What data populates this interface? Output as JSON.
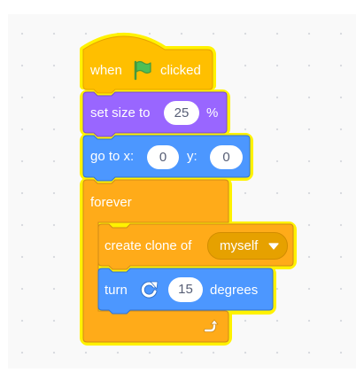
{
  "colors": {
    "events": "#ffbf00",
    "control": "#ffab19",
    "looks": "#9966ff",
    "motion": "#4c97ff",
    "glow": "#fff200"
  },
  "blocks": {
    "when_flag": {
      "label_when": "when",
      "icon": "green-flag-icon",
      "label_clicked": "clicked"
    },
    "set_size": {
      "label": "set size to",
      "value": "25",
      "unit": "%"
    },
    "go_to": {
      "label_x": "go to x:",
      "x_value": "0",
      "label_y": "y:",
      "y_value": "0"
    },
    "forever": {
      "label": "forever",
      "loop_icon": "loop-arrow-icon"
    },
    "create_clone": {
      "label": "create clone of",
      "option": "myself",
      "dropdown_icon": "caret-down-icon"
    },
    "turn": {
      "label_turn": "turn",
      "icon": "rotate-right-icon",
      "value": "15",
      "label_degrees": "degrees"
    }
  }
}
